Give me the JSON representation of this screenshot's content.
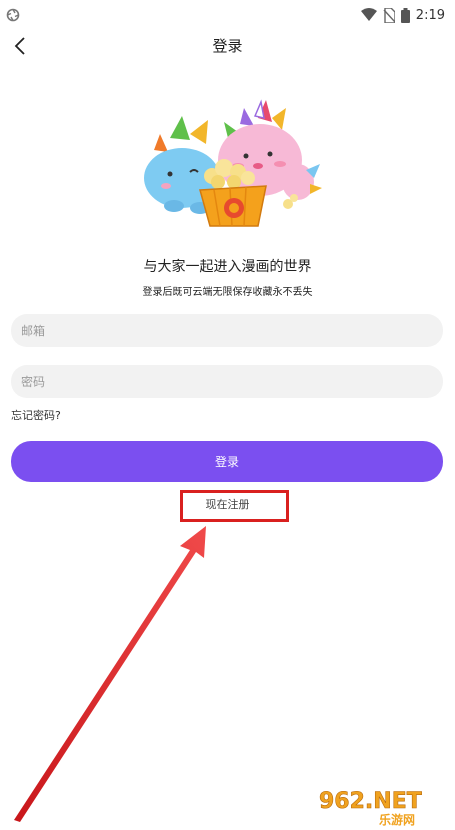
{
  "status_bar": {
    "time": "2:19"
  },
  "header": {
    "title": "登录",
    "back_icon": "chevron-left-icon"
  },
  "intro": {
    "headline": "与大家一起进入漫画的世界",
    "subline": "登录后既可云端无限保存收藏永不丢失"
  },
  "form": {
    "email_placeholder": "邮箱",
    "password_placeholder": "密码",
    "forgot_label": "忘记密码?",
    "login_label": "登录",
    "register_label": "现在注册"
  },
  "watermark": {
    "brand_text": "962.NET",
    "sub_text": "乐游网"
  },
  "colors": {
    "accent": "#7b4ff0",
    "annotation": "#d9201f",
    "field_bg": "#f2f2f2"
  }
}
